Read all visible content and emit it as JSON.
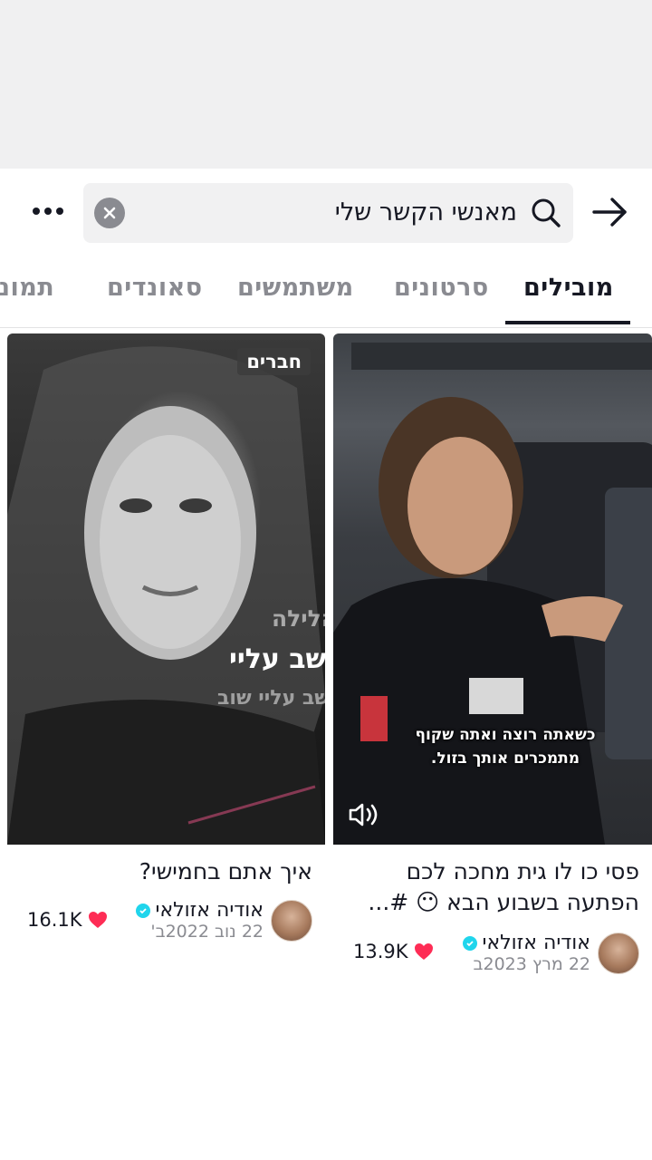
{
  "search": {
    "query": "מאנשי הקשר שלי",
    "icons": {
      "back": "arrow-right-icon",
      "search": "search-icon",
      "clear": "close-icon",
      "more": "more-dots-icon"
    }
  },
  "tabs": [
    {
      "label": "מובילים",
      "active": true
    },
    {
      "label": "סרטונים",
      "active": false
    },
    {
      "label": "משתמשים",
      "active": false
    },
    {
      "label": "סאונדים",
      "active": false
    },
    {
      "label": "תמונות",
      "active": false
    }
  ],
  "results": [
    {
      "badge": "",
      "overlay": {
        "subtitle": "כשאתה רוצה ואתה שקוף",
        "subtitle2": "מתמכרים אותך בזול."
      },
      "title_line1": "פסי כו לו גית מחכה לכם",
      "title_line2": "הפתעה בשבוע הבא 😶 #...",
      "author": "אודיה אזולאי",
      "date": "22 מרץ 2023ב",
      "likes": "13.9K"
    },
    {
      "badge": "חברים",
      "overlay": {
        "line1": "וכל הלילה",
        "line2": "אתה חושב עליי",
        "line3": "אתה חושב עליי שוב"
      },
      "title_line1": "איך אתם בחמישי?",
      "author": "אודיה אזולאי",
      "date": "22 נוב 2022ב'",
      "likes": "16.1K"
    }
  ],
  "colors": {
    "accent": "#fe2c55",
    "verified": "#20d5ec",
    "text": "#161823",
    "muted": "#8a8b91"
  }
}
